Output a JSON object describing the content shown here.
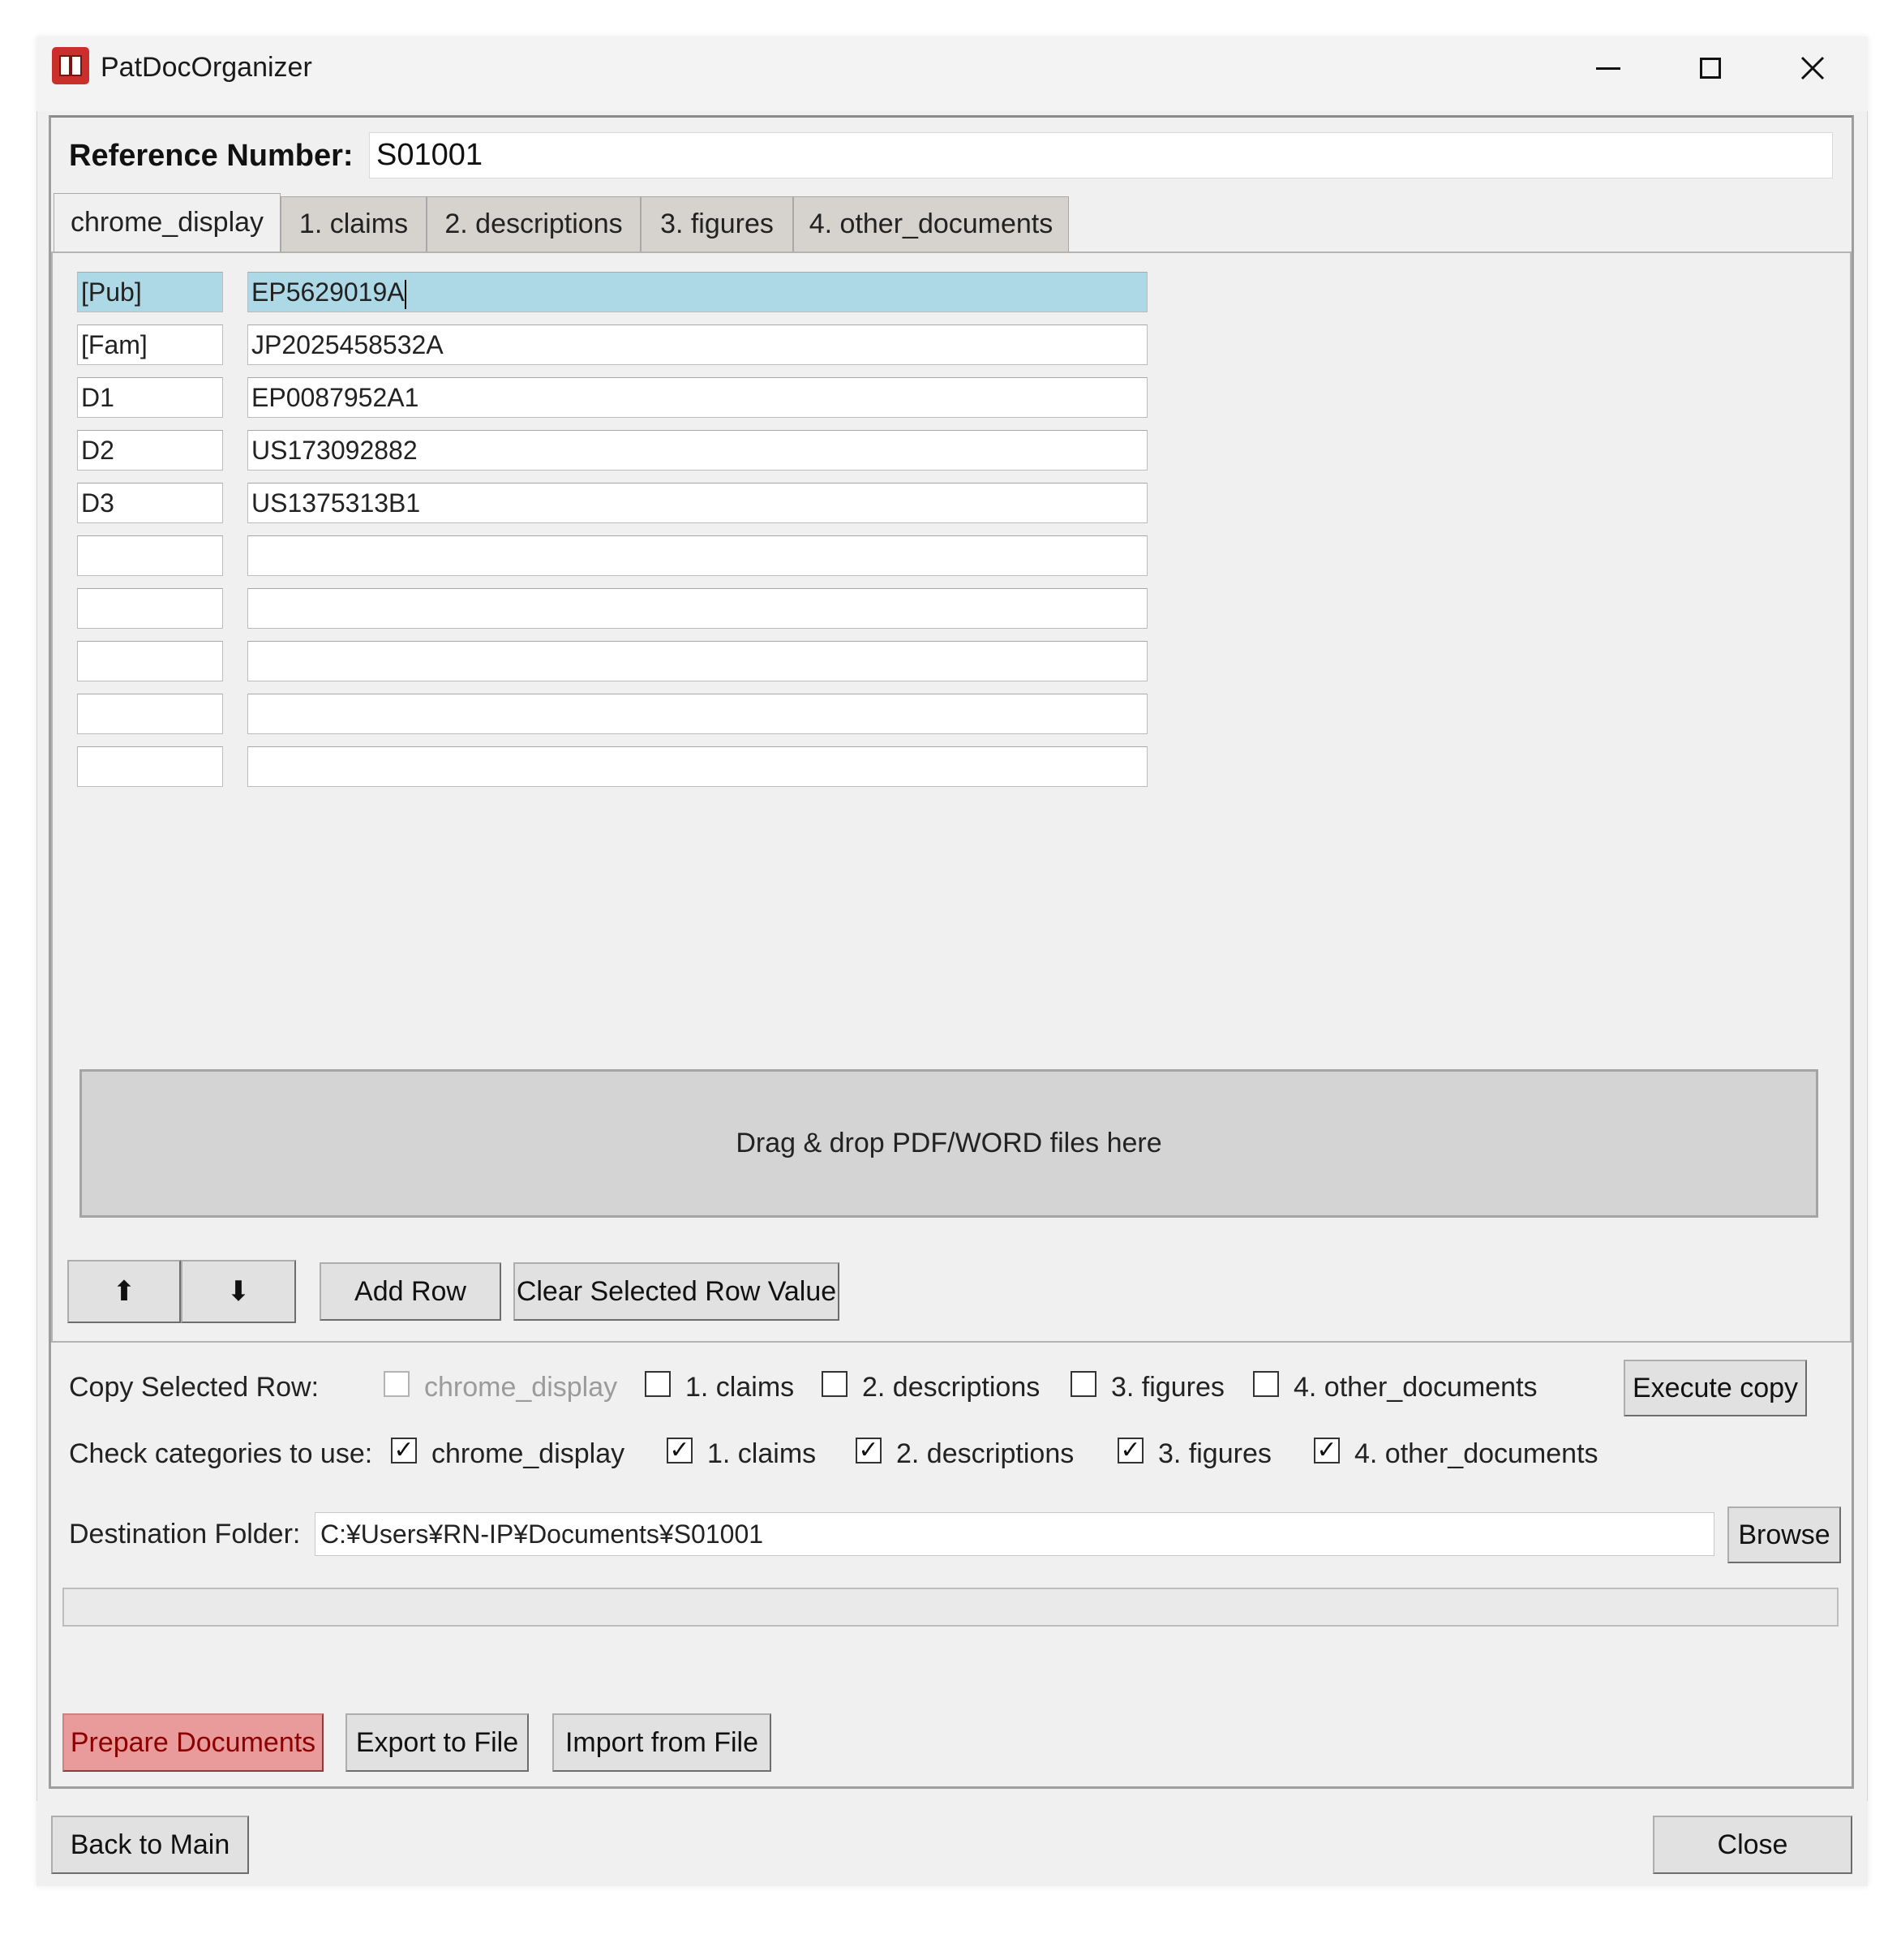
{
  "window": {
    "title": "PatDocOrganizer",
    "minimize_icon": "minimize-icon",
    "maximize_icon": "maximize-icon",
    "close_icon": "close-icon"
  },
  "reference": {
    "label": "Reference Number:",
    "value": "S01001"
  },
  "tabs": [
    {
      "label": "chrome_display",
      "active": true
    },
    {
      "label": "1. claims",
      "active": false
    },
    {
      "label": "2. descriptions",
      "active": false
    },
    {
      "label": "3. figures",
      "active": false
    },
    {
      "label": "4. other_documents",
      "active": false
    }
  ],
  "rows": [
    {
      "key": "[Pub]",
      "value": "EP5629019A",
      "selected": true
    },
    {
      "key": "[Fam]",
      "value": "JP2025458532A",
      "selected": false
    },
    {
      "key": "D1",
      "value": "EP0087952A1",
      "selected": false
    },
    {
      "key": "D2",
      "value": "US173092882",
      "selected": false
    },
    {
      "key": "D3",
      "value": "US1375313B1",
      "selected": false
    },
    {
      "key": "",
      "value": "",
      "selected": false
    },
    {
      "key": "",
      "value": "",
      "selected": false
    },
    {
      "key": "",
      "value": "",
      "selected": false
    },
    {
      "key": "",
      "value": "",
      "selected": false
    },
    {
      "key": "",
      "value": "",
      "selected": false
    }
  ],
  "dropzone": {
    "text": "Drag & drop PDF/WORD files here"
  },
  "row_controls": {
    "move_up_icon": "⬆",
    "move_down_icon": "⬇",
    "add_row": "Add Row",
    "clear_selected": "Clear Selected Row Value"
  },
  "copy_row": {
    "label": "Copy Selected Row:",
    "options": [
      {
        "label": "chrome_display",
        "checked": false,
        "disabled": true
      },
      {
        "label": "1. claims",
        "checked": false,
        "disabled": false
      },
      {
        "label": "2. descriptions",
        "checked": false,
        "disabled": false
      },
      {
        "label": "3. figures",
        "checked": false,
        "disabled": false
      },
      {
        "label": "4. other_documents",
        "checked": false,
        "disabled": false
      }
    ],
    "execute": "Execute copy"
  },
  "categories": {
    "label": "Check categories to use:",
    "options": [
      {
        "label": "chrome_display",
        "checked": true
      },
      {
        "label": "1. claims",
        "checked": true
      },
      {
        "label": "2. descriptions",
        "checked": true
      },
      {
        "label": "3. figures",
        "checked": true
      },
      {
        "label": "4. other_documents",
        "checked": true
      }
    ]
  },
  "destination": {
    "label": "Destination Folder:",
    "value": "C:¥Users¥RN-IP¥Documents¥S01001",
    "browse": "Browse"
  },
  "progress": {
    "value_percent": 0
  },
  "actions": {
    "prepare": "Prepare Documents",
    "export": "Export to File",
    "import": "Import from File"
  },
  "footer": {
    "back": "Back to Main",
    "close": "Close"
  },
  "colors": {
    "selected_row": "#add8e6",
    "prepare_button": "#e99a9a",
    "dropzone": "#d4d4d4"
  }
}
